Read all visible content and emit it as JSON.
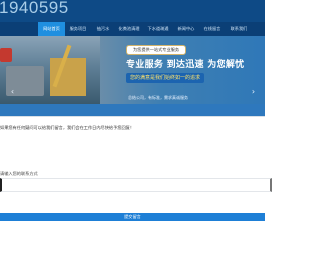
{
  "header": {
    "phone": "1940595"
  },
  "nav": {
    "items": [
      {
        "label": "网站首页"
      },
      {
        "label": "服务项目"
      },
      {
        "label": "抽污水"
      },
      {
        "label": "化粪池清理"
      },
      {
        "label": "下水道疏通"
      },
      {
        "label": "新闻中心"
      },
      {
        "label": "在线留言"
      },
      {
        "label": "联系我们"
      }
    ]
  },
  "banner": {
    "badge": "为您提供一站式专业服务",
    "slogan": "专业服务 到达迅速 为您解忧",
    "subline": "您的满意是我们始终如一的追求",
    "desc": "总结公司，有标准，需求真诚服务",
    "prev_icon": "chevron-left-icon",
    "next_icon": "chevron-right-icon"
  },
  "modal": {
    "message": "如果您有任何疑问可以给我们留言，我们会在工作日内尽快给予您回复！",
    "label": "请输入您的联系方式",
    "input_placeholder": "",
    "submit_label": "提交留言"
  },
  "colors": {
    "header_bg": "#0e4a86",
    "nav_bg": "#0b3f76",
    "nav_active": "#1f8fe0",
    "button_bg": "#1e7fd6"
  }
}
